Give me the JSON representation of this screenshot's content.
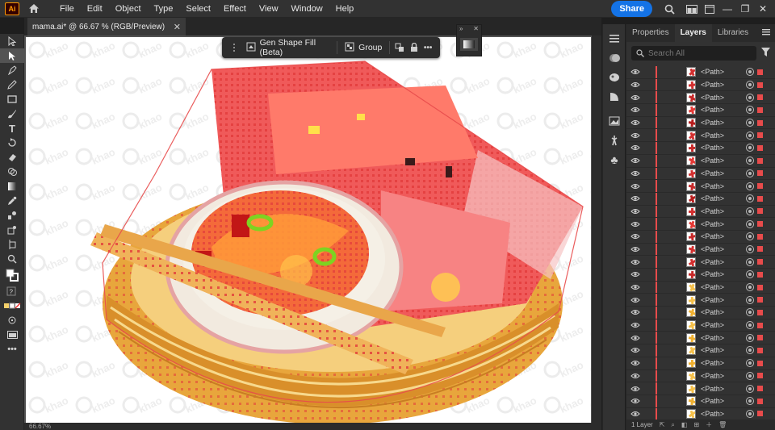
{
  "app": {
    "logo": "Ai",
    "name": "Adobe Illustrator"
  },
  "menu": [
    "File",
    "Edit",
    "Object",
    "Type",
    "Select",
    "Effect",
    "View",
    "Window",
    "Help"
  ],
  "menubar_right": {
    "share_label": "Share",
    "icons": [
      "search-icon",
      "arrange-documents-icon",
      "workspace-icon"
    ]
  },
  "window_controls": {
    "minimize": "—",
    "maximize": "❐",
    "close": "✕"
  },
  "document_tab": {
    "title": "mama.ai* @ 66.67 % (RGB/Preview)",
    "close": "✕"
  },
  "taskbar": {
    "gen_shape_fill_label": "Gen Shape Fill (Beta)",
    "group_label": "Group",
    "more": "•••"
  },
  "canvas": {
    "zoom_readout": "66.67%",
    "watermark_text": "khao"
  },
  "tools": [
    "selection-tool",
    "direct-selection-tool",
    "pen-tool",
    "pencil-tool",
    "rectangle-tool",
    "paintbrush-tool",
    "type-tool",
    "rotate-tool",
    "eraser-tool",
    "shape-builder-tool",
    "gradient-tool",
    "eyedropper-tool",
    "blend-tool",
    "symbol-sprayer-tool",
    "artboard-tool",
    "zoom-tool",
    "fill-stroke-swatch",
    "color-mode-icons",
    "draw-mode-icon",
    "screen-mode-icon",
    "more-tools"
  ],
  "panel": {
    "tabs": [
      "Properties",
      "Layers",
      "Libraries"
    ],
    "active_tab": "Layers",
    "search_placeholder": "Search All",
    "layer_name": "<Path>",
    "layer_count": 28,
    "footer_text": "1 Layer"
  },
  "colors": {
    "accent_blue": "#1473e6",
    "selection_red": "#e84b4b",
    "chrome": "#323232",
    "canvas_bg": "#535353"
  }
}
